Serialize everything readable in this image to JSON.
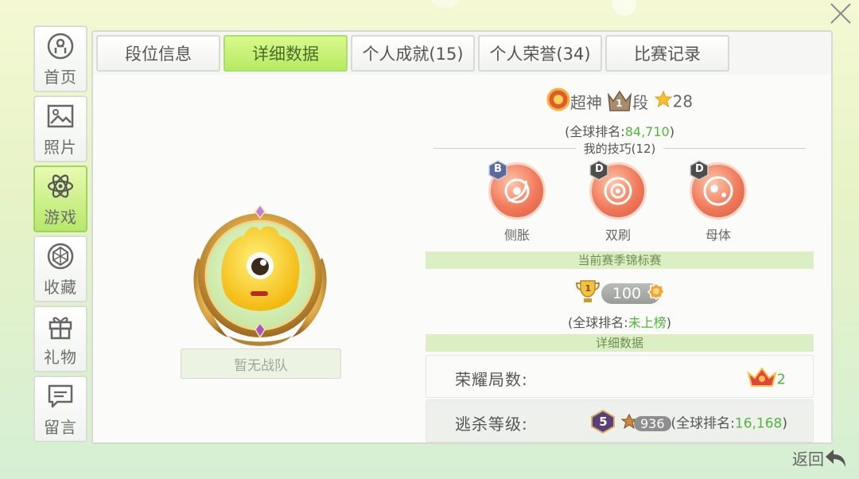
{
  "sidebar": {
    "items": [
      {
        "label": "首页",
        "icon": "home-icon",
        "active": false
      },
      {
        "label": "照片",
        "icon": "photo-icon",
        "active": false
      },
      {
        "label": "游戏",
        "icon": "atom-icon",
        "active": true
      },
      {
        "label": "收藏",
        "icon": "collection-icon",
        "active": false
      },
      {
        "label": "礼物",
        "icon": "gift-icon",
        "active": false
      },
      {
        "label": "留言",
        "icon": "message-icon",
        "active": false
      }
    ]
  },
  "tabs": [
    {
      "label": "段位信息",
      "active": false
    },
    {
      "label": "详细数据",
      "active": true
    },
    {
      "label": "个人成就(15)",
      "active": false
    },
    {
      "label": "个人荣誉(34)",
      "active": false
    },
    {
      "label": "比赛记录",
      "active": false
    }
  ],
  "team": {
    "label": "暂无战队"
  },
  "rank": {
    "tier_name": "超神",
    "level": "1",
    "duan": "段",
    "stars": "28",
    "global_prefix": "(全球排名:",
    "global_value": "84,710",
    "global_suffix": ")"
  },
  "skills": {
    "title": "我的技巧(12)",
    "items": [
      {
        "name": "侧胀",
        "grade": "B"
      },
      {
        "name": "双刷",
        "grade": "D"
      },
      {
        "name": "母体",
        "grade": "D"
      }
    ]
  },
  "championship": {
    "title": "当前赛季锦标赛",
    "trophy_level": "1",
    "score": "100",
    "global_prefix": "(全球排名:",
    "global_value": "未上榜",
    "global_suffix": ")"
  },
  "details": {
    "title": "详细数据",
    "glory_label": "荣耀局数:",
    "glory_value": "2",
    "escape_label": "逃杀等级:",
    "escape_level": "5",
    "escape_score": "936",
    "escape_rank_prefix": "(全球排名:",
    "escape_rank_value": "16,168",
    "escape_rank_suffix": ")"
  },
  "back": {
    "label": "返回"
  },
  "colors": {
    "accent_green": "#4fb83a",
    "active_tab": "#b6ea63",
    "section_bar": "#dcefc4"
  }
}
